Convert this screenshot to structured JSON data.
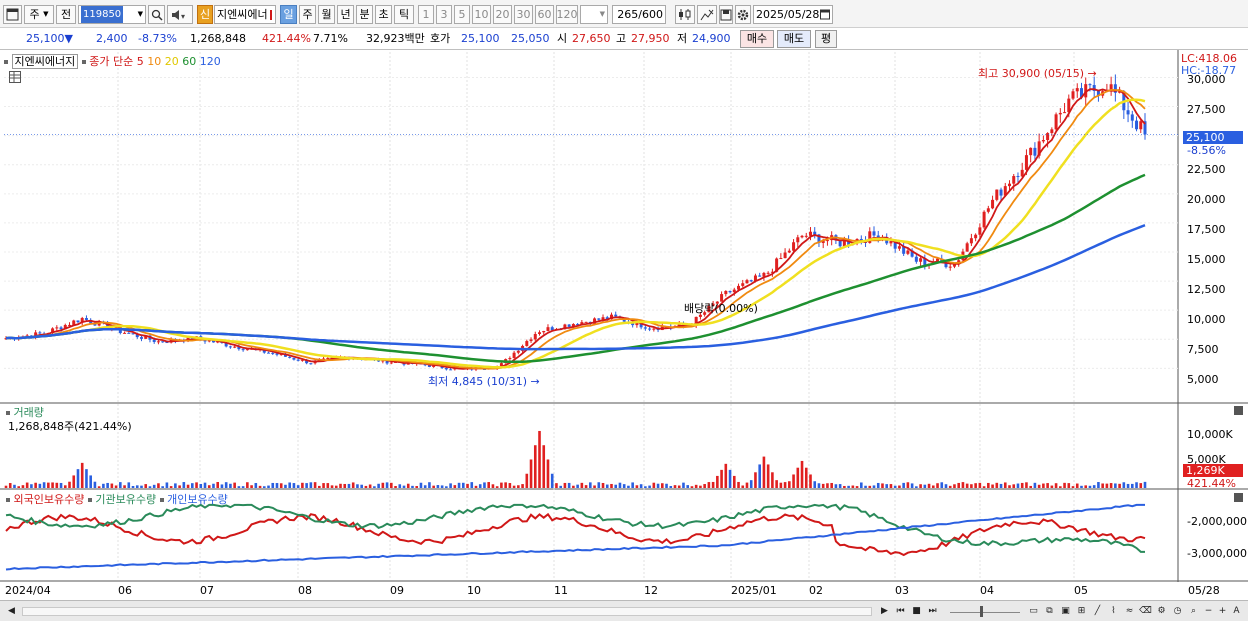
{
  "toolbar": {
    "period_label": "주",
    "prev_label": "전",
    "code_value": "119850",
    "new_badge": "신",
    "stock_name": "지엔씨에너",
    "intervals": [
      "일",
      "주",
      "월",
      "년",
      "분",
      "초",
      "틱"
    ],
    "active_interval": "일",
    "numbers": [
      "1",
      "3",
      "5",
      "10",
      "20",
      "30",
      "60",
      "120"
    ],
    "count_value": "265",
    "count_max": "/600",
    "date_value": "2025/05/28",
    "icons": [
      "window-icon",
      "search-icon",
      "speaker-icon",
      "candle-icon",
      "crosshair-icon",
      "save-icon",
      "gear-icon",
      "calendar-icon"
    ]
  },
  "quote": {
    "price": "25,100",
    "arrow": "▼",
    "change": "2,400",
    "change_pct": "-8.73%",
    "volume": "1,268,848",
    "volume_ratio": "421.44%",
    "turnover_rate": "7.71%",
    "amount": "32,923백만",
    "hoga_label": "호가",
    "ask": "25,100",
    "bid": "25,050",
    "open_label": "시",
    "open": "27,650",
    "high_label": "고",
    "high": "27,950",
    "low_label": "저",
    "low": "24,900",
    "buy_label": "매수",
    "sell_label": "매도",
    "eval_label": "평"
  },
  "price_pane": {
    "stock_tag": "지엔씨에너지",
    "ma_title": "종가 단순",
    "ma_periods": [
      "5",
      "10",
      "20",
      "60",
      "120"
    ],
    "ma_colors": [
      "#d01818",
      "#f08a10",
      "#f0e020",
      "#1e9030",
      "#2a5fe0"
    ],
    "lc_label": "LC:418.06",
    "hc_label": "HC:-18.77",
    "max_note": "최고 30,900 (05/15) →",
    "min_note": "최저 4,845 (10/31) →",
    "dividend_note": "배당락(0.00%)",
    "current_price_tag": "25,100",
    "current_pct_tag": "-8.56%",
    "y_ticks": [
      "30,000",
      "27,500",
      "22,500",
      "20,000",
      "17,500",
      "15,000",
      "12,500",
      "10,000",
      "7,500",
      "5,000"
    ]
  },
  "volume_pane": {
    "title": "거래량",
    "value_text": "1,268,848주(421.44%)",
    "y_ticks": [
      "10,000K",
      "5,000K"
    ],
    "current_tag": "1,269K",
    "current_pct_tag": "421.44%"
  },
  "holding_pane": {
    "foreign_label": "외국인보유수량",
    "institution_label": "기관보유수량",
    "individual_label": "개인보유수량",
    "y_ticks": [
      "-2,000,000",
      "-3,000,000"
    ]
  },
  "x_axis": {
    "labels": [
      "2024/04",
      "06",
      "07",
      "08",
      "09",
      "10",
      "11",
      "12",
      "2025/01",
      "02",
      "03",
      "04",
      "05"
    ],
    "end_label": "05/28"
  },
  "chart_data": {
    "type": "candlestick",
    "title": "",
    "x_range": [
      "2024/04",
      "2025/05/28"
    ],
    "ylim": [
      4000,
      31500
    ],
    "max": {
      "value": 30900,
      "date": "05/15"
    },
    "min": {
      "value": 4845,
      "date": "10/31"
    },
    "close_anchors": [
      [
        "2024/04",
        7600
      ],
      [
        "04-mid",
        8000
      ],
      [
        "05",
        9300
      ],
      [
        "05-mid",
        8200
      ],
      [
        "06",
        7300
      ],
      [
        "07",
        7600
      ],
      [
        "07-mid",
        6900
      ],
      [
        "08",
        6300
      ],
      [
        "08-mid",
        5500
      ],
      [
        "09",
        6000
      ],
      [
        "09-mid",
        5600
      ],
      [
        "10",
        5300
      ],
      [
        "10/31",
        4900
      ],
      [
        "11",
        5200
      ],
      [
        "11-mid",
        8200
      ],
      [
        "12",
        8900
      ],
      [
        "12-mid",
        9400
      ],
      [
        "12-end",
        8500
      ],
      [
        "2025/01",
        8700
      ],
      [
        "01-mid",
        11500
      ],
      [
        "02",
        13000
      ],
      [
        "02-mid",
        16500
      ],
      [
        "03",
        15800
      ],
      [
        "03-mid",
        16500
      ],
      [
        "03-end",
        14200
      ],
      [
        "04",
        14000
      ],
      [
        "04-mid",
        19500
      ],
      [
        "04-end",
        23500
      ],
      [
        "05",
        28000
      ],
      [
        "05/15",
        29500
      ],
      [
        "05/28",
        25100
      ]
    ],
    "volume_spikes_k": [
      [
        "05",
        5200
      ],
      [
        "11-mid",
        11800
      ],
      [
        "01-mid",
        5000
      ],
      [
        "02",
        6500
      ],
      [
        "02-mid",
        5600
      ],
      [
        "05/28",
        1269
      ]
    ],
    "holdings_series": [
      {
        "name": "외국인보유수량",
        "color": "#d01818",
        "range": [
          -3300000,
          -1700000
        ]
      },
      {
        "name": "기관보유수량",
        "color": "#2a8a5a",
        "range": [
          -3400000,
          -1700000
        ]
      },
      {
        "name": "개인보유수량",
        "color": "#2a5fe0",
        "range": [
          -3600000,
          -1700000
        ]
      }
    ]
  }
}
